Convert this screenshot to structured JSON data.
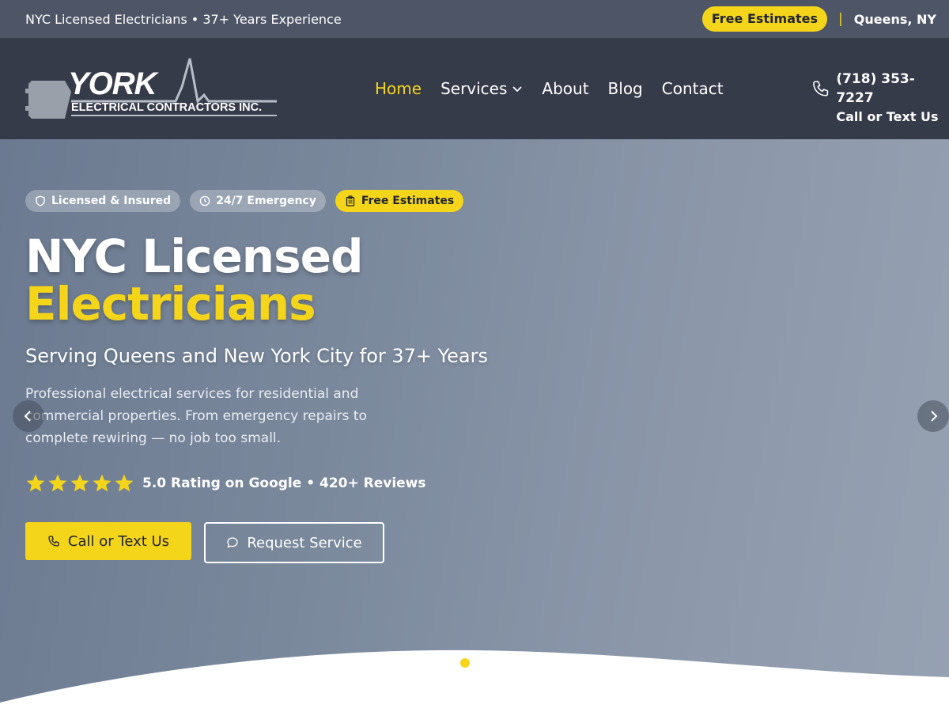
{
  "topbar": {
    "tagline": "NYC Licensed Electricians • 37+ Years Experience",
    "estimates_pill": "Free Estimates",
    "separator": "|",
    "location": "Queens, NY"
  },
  "logo": {
    "name": "YORK",
    "subtitle": "ELECTRICAL CONTRACTORS INC."
  },
  "nav": {
    "items": [
      {
        "label": "Home",
        "active": true
      },
      {
        "label": "Services",
        "dropdown": true
      },
      {
        "label": "About"
      },
      {
        "label": "Blog"
      },
      {
        "label": "Contact"
      }
    ]
  },
  "contact": {
    "phone": "(718) 353-7227",
    "cta": "Call or Text Us"
  },
  "hero": {
    "badges": [
      {
        "label": "Licensed & Insured",
        "icon": "shield-icon"
      },
      {
        "label": "24/7 Emergency",
        "icon": "clock-icon"
      },
      {
        "label": "Free Estimates",
        "icon": "clipboard-icon"
      }
    ],
    "headline_line1": "NYC Licensed",
    "headline_line2": "Electricians",
    "subheadline": "Serving Queens and New York City for 37+ Years",
    "description": "Professional electrical services for residential and commercial properties. From emergency repairs to complete rewiring — no job too small.",
    "rating": {
      "stars": 5,
      "text": "5.0 Rating on Google • 420+ Reviews"
    },
    "primary_button": "Call or Text Us",
    "secondary_button": "Request Service",
    "slide_count": 1,
    "active_slide": 1
  },
  "colors": {
    "accent": "#f5d51a",
    "topbar_bg": "#4d5567",
    "header_bg": "#353b49",
    "text_light": "#ffffff"
  }
}
